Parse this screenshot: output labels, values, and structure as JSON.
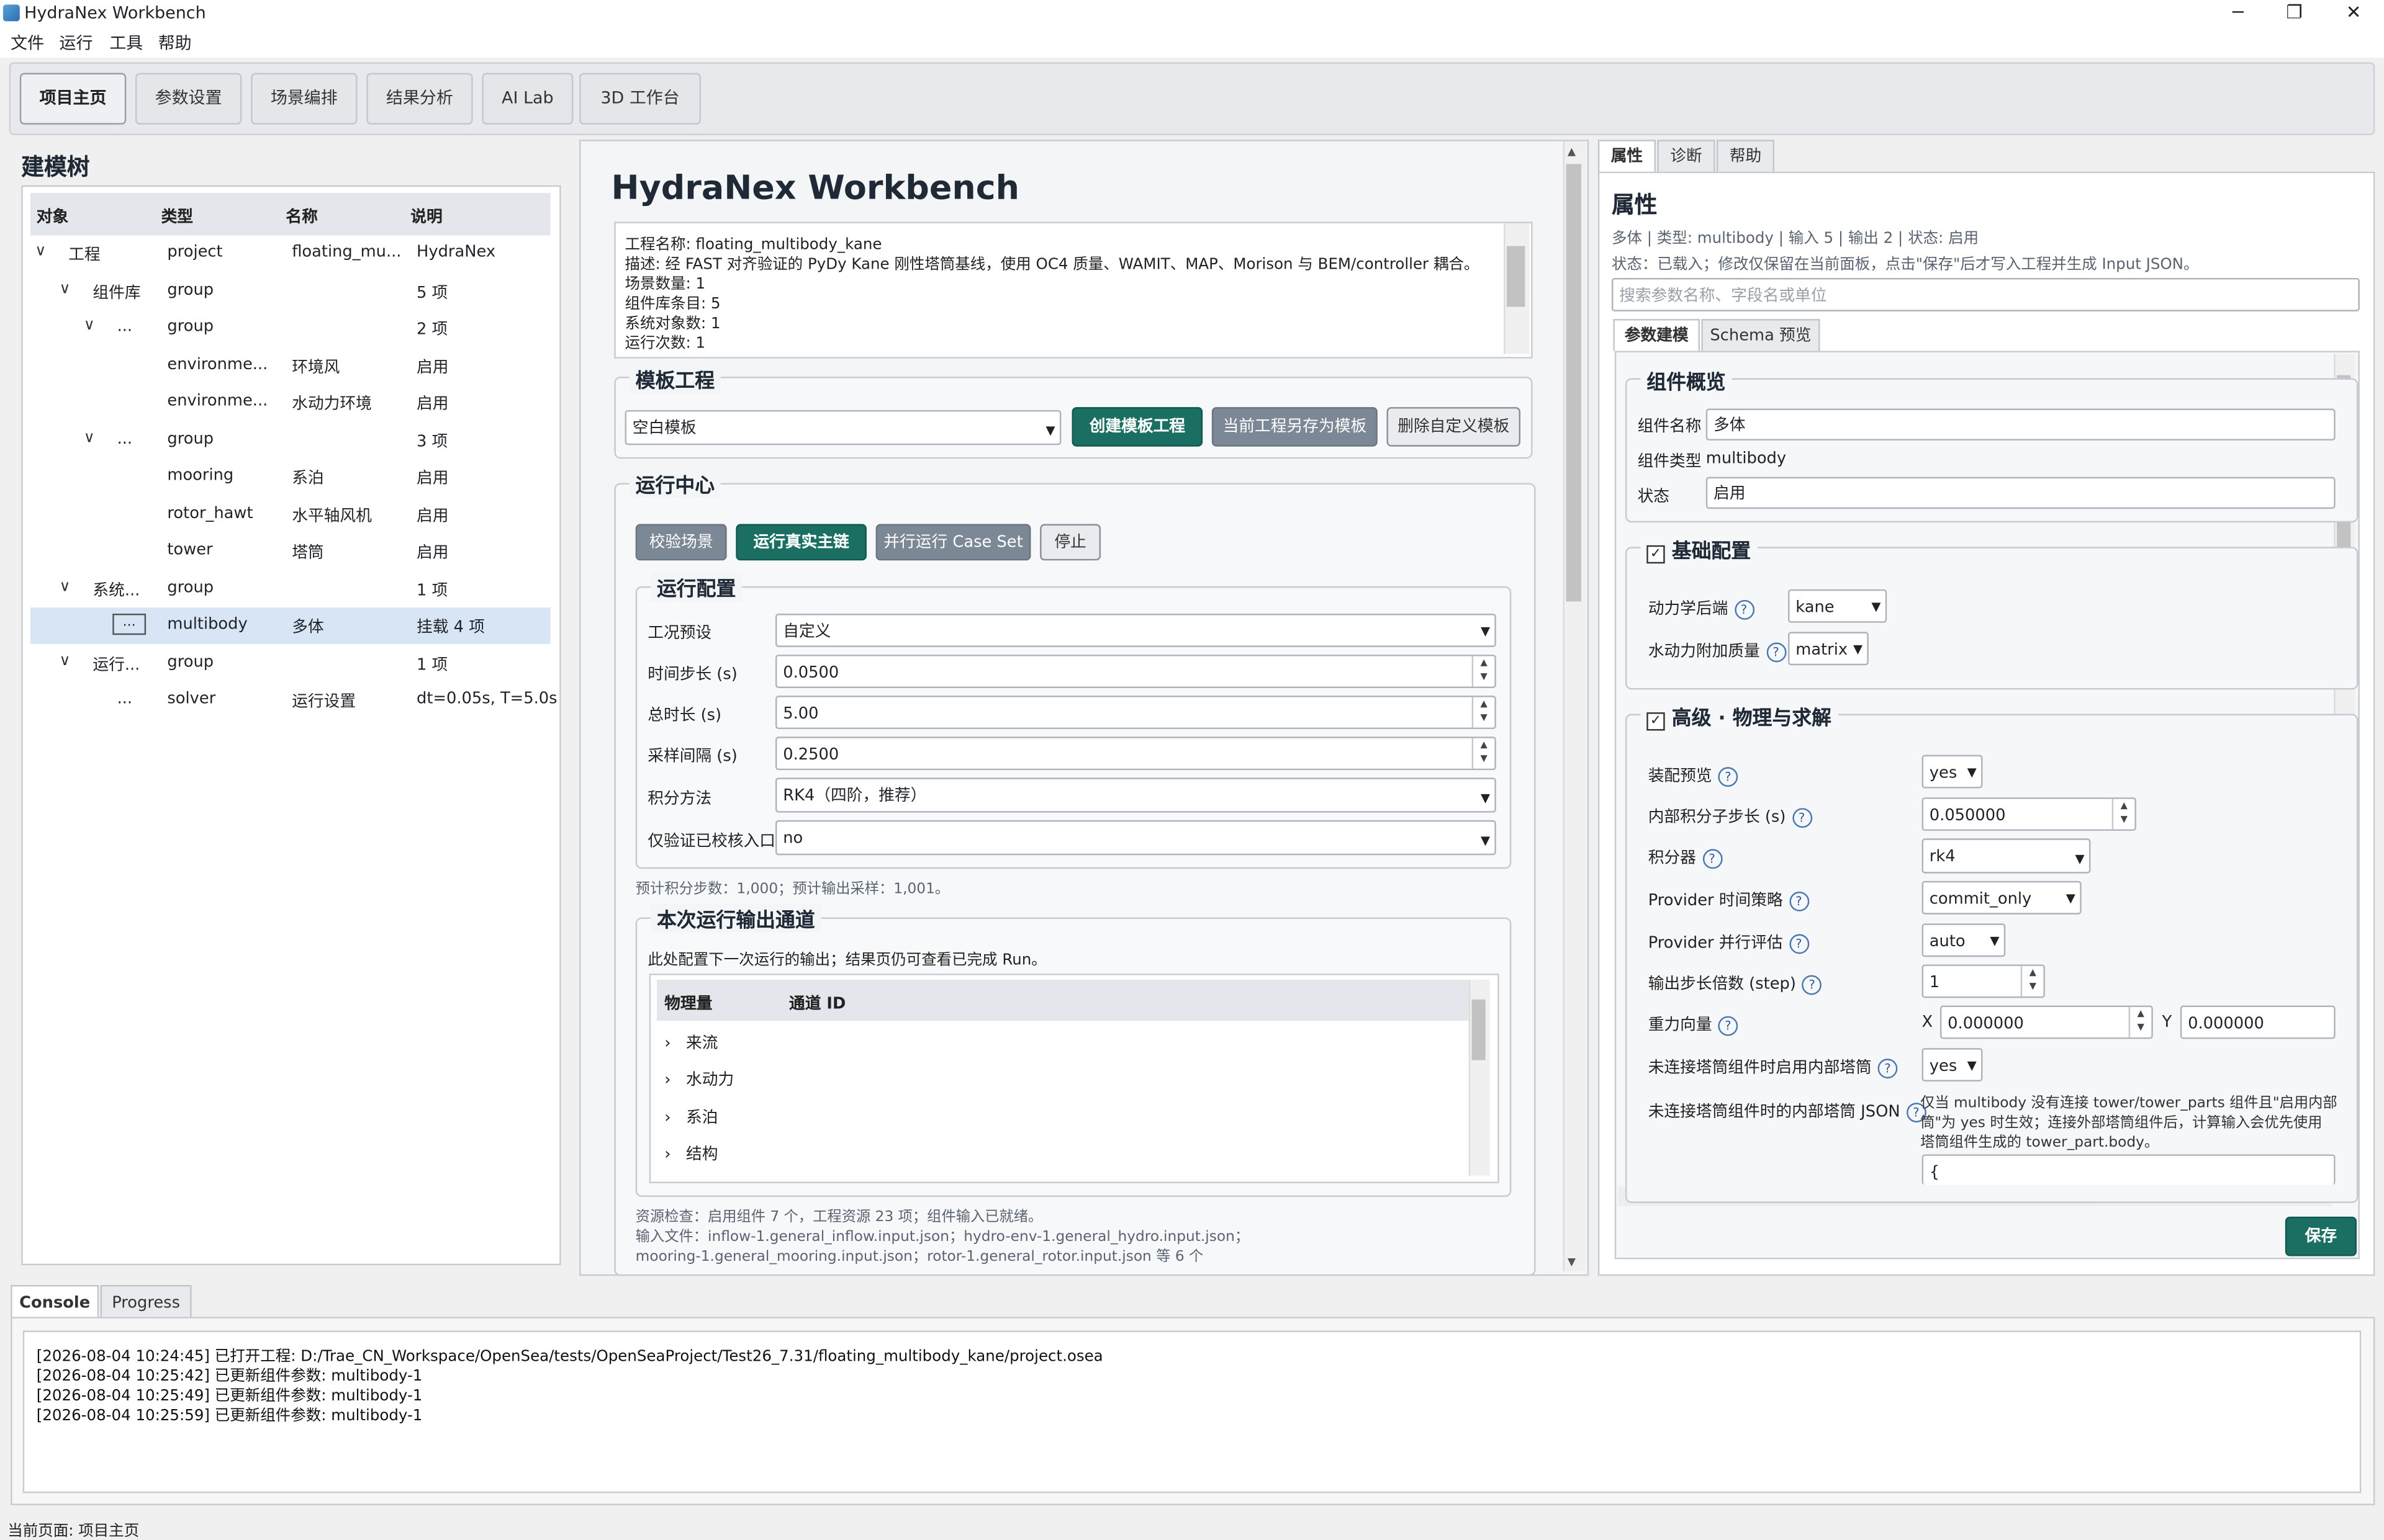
{
  "window": {
    "title": "HydraNex Workbench",
    "controls": [
      "─",
      "❐",
      "✕"
    ]
  },
  "menu": [
    "文件",
    "运行",
    "工具",
    "帮助"
  ],
  "nav_tabs": [
    "项目主页",
    "参数设置",
    "场景编排",
    "结果分析",
    "AI Lab",
    "3D 工作台"
  ],
  "tree": {
    "title": "建模树",
    "columns": [
      "对象",
      "类型",
      "名称",
      "说明"
    ],
    "rows": [
      {
        "chev": "∨",
        "obj": "工程",
        "type": "project",
        "name": "floating_mu...",
        "desc": "HydraNex"
      },
      {
        "chev": "∨",
        "obj": "组件库",
        "type": "group",
        "name": "",
        "desc": "5 项"
      },
      {
        "chev": "∨",
        "obj": "...",
        "type": "group",
        "name": "",
        "desc": "2 项"
      },
      {
        "chev": "",
        "obj": "",
        "type": "environme...",
        "name": "环境风",
        "desc": "启用"
      },
      {
        "chev": "",
        "obj": "",
        "type": "environme...",
        "name": "水动力环境",
        "desc": "启用"
      },
      {
        "chev": "∨",
        "obj": "...",
        "type": "group",
        "name": "",
        "desc": "3 项"
      },
      {
        "chev": "",
        "obj": "",
        "type": "mooring",
        "name": "系泊",
        "desc": "启用"
      },
      {
        "chev": "",
        "obj": "",
        "type": "rotor_hawt",
        "name": "水平轴风机",
        "desc": "启用"
      },
      {
        "chev": "",
        "obj": "",
        "type": "tower",
        "name": "塔筒",
        "desc": "启用"
      },
      {
        "chev": "∨",
        "obj": "系统...",
        "type": "group",
        "name": "",
        "desc": "1 项"
      },
      {
        "chev": "",
        "obj": "...",
        "type": "multibody",
        "name": "多体",
        "desc": "挂载 4 项"
      },
      {
        "chev": "∨",
        "obj": "运行...",
        "type": "group",
        "name": "",
        "desc": "1 项"
      },
      {
        "chev": "",
        "obj": "...",
        "type": "solver",
        "name": "运行设置",
        "desc": "dt=0.05s, T=5.0s"
      }
    ]
  },
  "center": {
    "title": "HydraNex Workbench",
    "info_lines": [
      "工程名称: floating_multibody_kane",
      "描述: 经 FAST 对齐验证的 PyDy Kane 刚性塔筒基线，使用 OC4 质量、WAMIT、MAP、Morison 与 BEM/controller 耦合。",
      "场景数量: 1",
      "组件库条目: 5",
      "系统对象数: 1",
      "运行次数: 1"
    ],
    "template": {
      "title": "模板工程",
      "select": "空白模板",
      "create_btn": "创建模板工程",
      "save_as_btn": "当前工程另存为模板",
      "delete_btn": "删除自定义模板"
    },
    "run_center": {
      "title": "运行中心",
      "validate_btn": "校验场景",
      "run_btn": "运行真实主链",
      "parallel_btn": "并行运行 Case Set",
      "stop_btn": "停止"
    },
    "run_config": {
      "title": "运行配置",
      "fields": [
        {
          "label": "工况预设",
          "value": "自定义",
          "kind": "dropdown"
        },
        {
          "label": "时间步长 (s)",
          "value": "0.0500",
          "kind": "spin"
        },
        {
          "label": "总时长 (s)",
          "value": "5.00",
          "kind": "spin"
        },
        {
          "label": "采样间隔 (s)",
          "value": "0.2500",
          "kind": "spin"
        },
        {
          "label": "积分方法",
          "value": "RK4（四阶，推荐）",
          "kind": "dropdown"
        },
        {
          "label": "仅验证已校核入口",
          "value": "no",
          "kind": "dropdown"
        }
      ],
      "estimate": "预计积分步数：1,000；预计输出采样：1,001。"
    },
    "output_channels": {
      "title": "本次运行输出通道",
      "desc": "此处配置下一次运行的输出；结果页仍可查看已完成 Run。",
      "columns": [
        "物理量",
        "通道 ID"
      ],
      "items": [
        "来流",
        "水动力",
        "系泊",
        "结构"
      ]
    },
    "resources": [
      "资源检查：启用组件 7 个，工程资源 23 项；组件输入已就绪。",
      "输入文件：inflow-1.general_inflow.input.json；hydro-env-1.general_hydro.input.json；",
      "mooring-1.general_mooring.input.json；rotor-1.general_rotor.input.json 等 6 个"
    ]
  },
  "right": {
    "tabs": [
      "属性",
      "诊断",
      "帮助"
    ],
    "title": "属性",
    "summary": "多体 | 类型: multibody | 输入 5 | 输出 2 | 状态: 启用",
    "status": "状态：已载入；修改仅保留在当前面板，点击\"保存\"后才写入工程并生成 Input JSON。",
    "search_placeholder": "搜索参数名称、字段名或单位",
    "subtabs": [
      "参数建模",
      "Schema 预览"
    ],
    "overview": {
      "title": "组件概览",
      "name_label": "组件名称",
      "name_value": "多体",
      "type_label": "组件类型",
      "type_value": "multibody",
      "state_label": "状态",
      "state_value": "启用"
    },
    "basic": {
      "title": "基础配置",
      "fields": [
        {
          "label": "动力学后端",
          "value": "kane"
        },
        {
          "label": "水动力附加质量",
          "value": "matrix"
        }
      ]
    },
    "advanced": {
      "title": "高级 · 物理与求解",
      "fields": [
        {
          "label": "装配预览",
          "value": "yes"
        },
        {
          "label": "内部积分子步长 (s)",
          "value": "0.050000"
        },
        {
          "label": "积分器",
          "value": "rk4"
        },
        {
          "label": "Provider 时间策略",
          "value": "commit_only"
        },
        {
          "label": "Provider 并行评估",
          "value": "auto"
        },
        {
          "label": "输出步长倍数 (step)",
          "value": "1"
        },
        {
          "label": "重力向量",
          "x_label": "X",
          "x": "0.000000",
          "y_label": "Y",
          "y": "0.000000"
        },
        {
          "label": "未连接塔筒组件时启用内部塔筒",
          "value": "yes"
        },
        {
          "label": "未连接塔筒组件时的内部塔筒 JSON",
          "note": [
            "仅当 multibody 没有连接 tower/tower_parts 组件且\"启用内部",
            "筒\"为 yes 时生效；连接外部塔筒组件后，计算输入会优先使用",
            "塔筒组件生成的 tower_part.body。"
          ],
          "json_value": "{"
        }
      ]
    },
    "save_btn": "保存"
  },
  "console": {
    "tabs": [
      "Console",
      "Progress"
    ],
    "lines": [
      "[2026-08-04 10:24:45] 已打开工程: D:/Trae_CN_Workspace/OpenSea/tests/OpenSeaProject/Test26_7.31/floating_multibody_kane/project.osea",
      "[2026-08-04 10:25:42] 已更新组件参数: multibody-1",
      "[2026-08-04 10:25:49] 已更新组件参数: multibody-1",
      "[2026-08-04 10:25:59] 已更新组件参数: multibody-1"
    ]
  },
  "statusbar": "当前页面: 项目主页",
  "colors": {
    "teal": "#1a6e62",
    "grey_btn": "#7d8896",
    "selection": "#d7e5f5"
  }
}
